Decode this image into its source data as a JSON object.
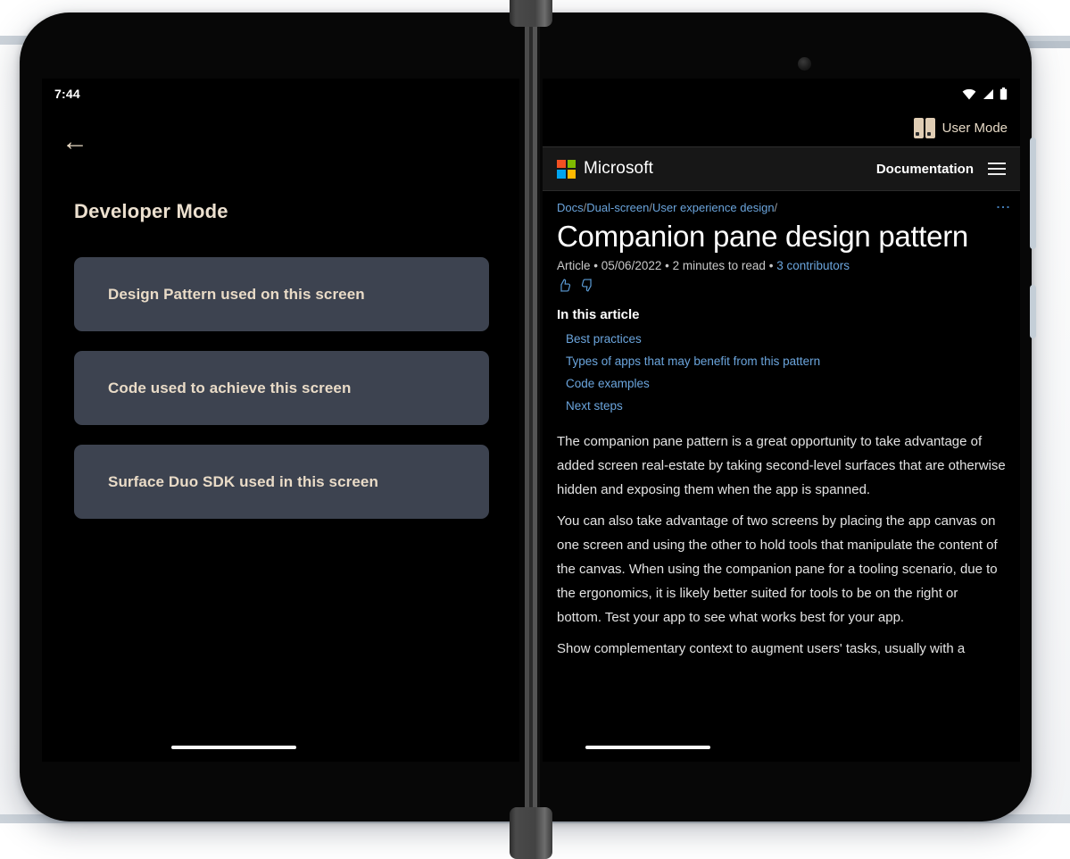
{
  "device": {
    "name": "Surface Duo dual-screen device",
    "camera": "front-camera"
  },
  "left_screen": {
    "status_bar": {
      "clock": "7:44"
    },
    "back_icon": "←",
    "title": "Developer Mode",
    "cards": [
      {
        "label": "Design Pattern used on this screen"
      },
      {
        "label": "Code used to achieve this screen"
      },
      {
        "label": "Surface Duo SDK used in this screen"
      }
    ]
  },
  "right_screen": {
    "status_icons": [
      "wifi-icon",
      "signal-icon",
      "battery-icon"
    ],
    "mode": {
      "label": "User Mode",
      "icon": "dual-screen-icon"
    },
    "app_bar": {
      "brand": "Microsoft",
      "section": "Documentation",
      "menu_icon": "hamburger-icon"
    },
    "breadcrumb": {
      "items": [
        "Docs",
        "Dual-screen",
        "User experience design"
      ],
      "separator": "/",
      "trailing_separator": "/",
      "more_icon": "kebab-menu-icon"
    },
    "article": {
      "title": "Companion pane design pattern",
      "meta_type": "Article",
      "meta_date": "05/06/2022",
      "meta_read_time": "2 minutes to read",
      "meta_contributors": "3 contributors",
      "meta_sep": "•",
      "feedback": [
        "thumbs-up-icon",
        "thumbs-down-icon"
      ],
      "toc_heading": "In this article",
      "toc_items": [
        "Best practices",
        "Types of apps that may benefit from this pattern",
        "Code examples",
        "Next steps"
      ],
      "paragraphs": [
        "The companion pane pattern is a great opportunity to take advantage of added screen real-estate by taking second-level surfaces that are otherwise hidden and exposing them when the app is spanned.",
        "You can also take advantage of two screens by placing the app canvas on one screen and using the other to hold tools that manipulate the content of the canvas. When using the companion pane for a tooling scenario, due to the ergonomics, it is likely better suited for tools to be on the right or bottom. Test your app to see what works best for your app.",
        "Show complementary context to augment users' tasks, usually with a"
      ]
    }
  },
  "colors": {
    "accent_tan": "#e9dbc7",
    "card_bg": "#3d4350",
    "link_blue": "#6ba5dd",
    "screen_bg": "#000000",
    "ms_red": "#f25022",
    "ms_green": "#7fba00",
    "ms_blue": "#00a4ef",
    "ms_yellow": "#ffb900"
  }
}
